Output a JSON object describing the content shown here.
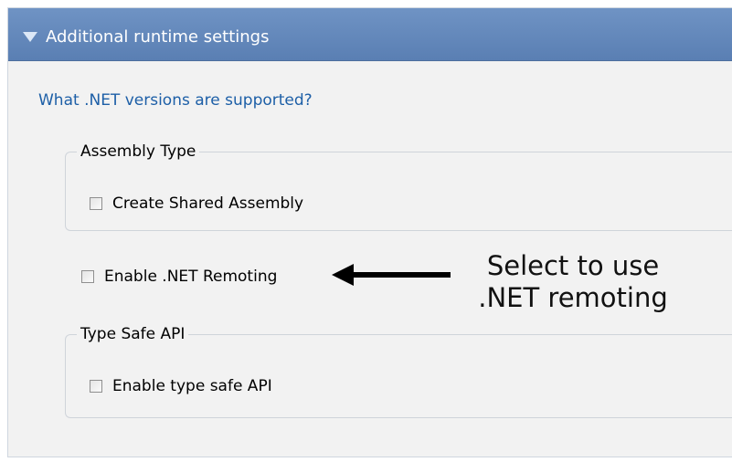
{
  "panel": {
    "title": "Additional runtime settings",
    "question_link": "What .NET versions are supported?"
  },
  "assembly_type": {
    "legend": "Assembly Type",
    "checkbox_label": "Create Shared Assembly",
    "checked": false
  },
  "remoting": {
    "checkbox_label": "Enable .NET Remoting",
    "checked": false
  },
  "type_safe_api": {
    "legend": "Type Safe API",
    "checkbox_label": "Enable type safe API",
    "checked": false
  },
  "annotation": {
    "line1": "Select to use",
    "line2": ".NET remoting",
    "arrow_icon": "left-arrow"
  },
  "colors": {
    "header_blue": "#5f83b8",
    "link_blue": "#1d5fa7",
    "panel_background": "#f2f2f2"
  }
}
